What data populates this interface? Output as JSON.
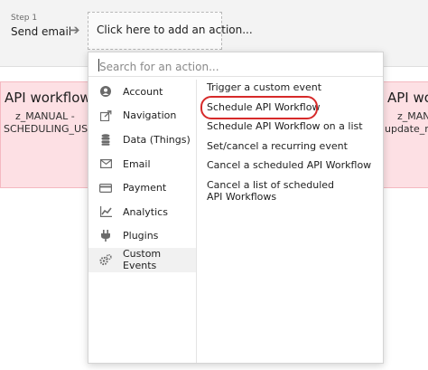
{
  "step": {
    "number": "Step 1",
    "title": "Send email"
  },
  "add_action": {
    "label": "Click here to add an action..."
  },
  "pink_left": {
    "title": "API workflow",
    "line1": "z_MANUAL -",
    "line2": "SCHEDULING_USERS"
  },
  "pink_right": {
    "title": "API wo",
    "line1": "z_MANU",
    "line2": "update_rec"
  },
  "search": {
    "placeholder": "Search for an action...",
    "value": ""
  },
  "categories": [
    {
      "label": "Account",
      "icon": "user-icon"
    },
    {
      "label": "Navigation",
      "icon": "navigation-icon"
    },
    {
      "label": "Data (Things)",
      "icon": "database-icon"
    },
    {
      "label": "Email",
      "icon": "envelope-icon"
    },
    {
      "label": "Payment",
      "icon": "credit-card-icon"
    },
    {
      "label": "Analytics",
      "icon": "bar-chart-icon"
    },
    {
      "label": "Plugins",
      "icon": "plug-icon"
    },
    {
      "label": "Custom Events",
      "icon": "gears-icon"
    }
  ],
  "active_category": "Custom Events",
  "actions": [
    "Trigger a custom event",
    "Schedule API Workflow",
    "Schedule API Workflow on a list",
    "Set/cancel a recurring event",
    "Cancel a scheduled API Workflow",
    "Cancel a list of scheduled API Workflows"
  ],
  "highlighted_action": "Schedule API Workflow",
  "colors": {
    "highlight_circle": "#d62a2a",
    "pink_panel": "#fde0e4"
  }
}
